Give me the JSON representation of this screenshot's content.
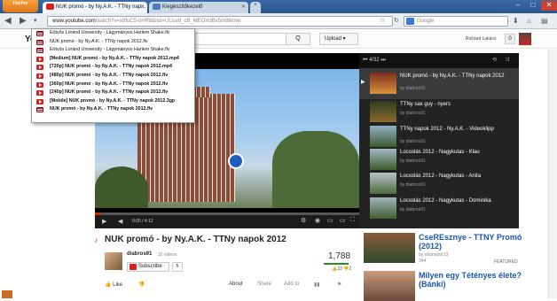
{
  "browser": {
    "menu_label": "Firefox",
    "tabs": [
      {
        "label": "NUK promó - by Ny.A.K. - TTNy nap..."
      },
      {
        "label": "Kiegészítőkezelő"
      }
    ],
    "new_tab": "+",
    "url_domain": "www.youtube.com",
    "url_path": "/watch?v=x8fuC5-nHR8&list=UUsvd_cB_MEOVdBx5m8tkmw",
    "search_placeholder": "Google",
    "window_controls": [
      "–",
      "□",
      "✕"
    ]
  },
  "youtube": {
    "logo": "Yo",
    "search_button": "Q",
    "upload": "Upload",
    "user": "Richard Lukács",
    "notifications": "0"
  },
  "download_menu": {
    "items": [
      {
        "label": "Eötvös Loránd University - Lágymányos Harlem Shake.flv",
        "bold": false,
        "icon": "flag-icon"
      },
      {
        "label": "NUK promó - by Ny.A.K. - TTNy napok 2012.flv",
        "bold": false,
        "icon": "flag-icon"
      },
      {
        "label": "Eötvös Loránd University - Lágymányos Harlem Shake.flv",
        "bold": false,
        "icon": "flag-icon"
      },
      {
        "label": "[Medium] NUK promó - by Ny.A.K. - TTNy napok 2012.mp4",
        "bold": true,
        "icon": "youtube-icon"
      },
      {
        "label": "[720p] NUK promó - by Ny.A.K. - TTNy napok 2012.mp4",
        "bold": true,
        "icon": "youtube-icon"
      },
      {
        "label": "[480p] NUK promó - by Ny.A.K. - TTNy napok 2012.flv",
        "bold": true,
        "icon": "youtube-icon"
      },
      {
        "label": "[360p] NUK promó - by Ny.A.K. - TTNy napok 2012.flv",
        "bold": true,
        "icon": "youtube-icon"
      },
      {
        "label": "[240p] NUK promó - by Ny.A.K. - TTNy napok 2012.flv",
        "bold": true,
        "icon": "youtube-icon"
      },
      {
        "label": "[Mobile] NUK promó - by Ny.A.K. - TTNy napok 2012.3gp",
        "bold": true,
        "icon": "youtube-icon"
      },
      {
        "label": "NUK promó - by Ny.A.K. - TTNy napok 2012.flv",
        "bold": true,
        "icon": "flag-icon"
      }
    ]
  },
  "player": {
    "time": "0:05 / 4:12",
    "progress": 0.02,
    "playlist_position": "4/32"
  },
  "playlist": [
    {
      "title": "NUK promó - by Ny.A.K. - TTNy napok 2012",
      "by": "by diabros91",
      "active": true
    },
    {
      "title": "TTNy sax guy - nyers",
      "by": "by diabros91",
      "active": false
    },
    {
      "title": "TTNy napok 2012 - Ny.A.K. - Videoklipp",
      "by": "by diabros91",
      "active": false
    },
    {
      "title": "Locsolás 2012 - Nagykutas - Klau",
      "by": "by diabros91",
      "active": false
    },
    {
      "title": "Locsolás 2012 - Nagykutas - Anita",
      "by": "by diabros91",
      "active": false
    },
    {
      "title": "Locsolás 2012 - Nagykutas - Dominika",
      "by": "by diabros91",
      "active": false
    }
  ],
  "video": {
    "title": "NUK promó - by Ny.A.K. - TTNy napok 2012",
    "channel": "diabros91",
    "channel_videos": "32 videos",
    "subscribe": "Subscribe",
    "subscribers": "5",
    "views": "1,788",
    "likes": "33",
    "dislikes": "2",
    "like_label": "Like",
    "tabs": [
      "About",
      "Share",
      "Add to"
    ]
  },
  "related": [
    {
      "title": "CseREsznye - TTNY Promó (2012)",
      "by": "by ebanador13",
      "views": "344",
      "featured": "FEATURED"
    },
    {
      "title": "Milyen egy Tétényes élete? (Bánki)",
      "by": "",
      "views": "",
      "featured": ""
    }
  ]
}
